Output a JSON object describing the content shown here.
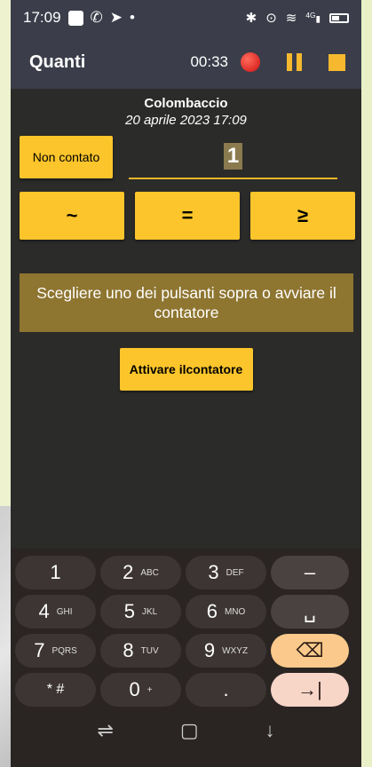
{
  "status_bar": {
    "time": "17:09",
    "icons_left": [
      "square-icon",
      "whatsapp-icon",
      "telegram-icon",
      "dot-icon"
    ],
    "icons_right": [
      "bluetooth-icon",
      "location-icon",
      "wifi-icon",
      "signal-icon",
      "battery-icon"
    ],
    "signal_label": "4G"
  },
  "app_bar": {
    "title": "Quanti",
    "timer": "00:33"
  },
  "session": {
    "name": "Colombaccio",
    "date": "20 aprile 2023 17:09"
  },
  "counter": {
    "not_counted_label": "Non contato",
    "value": "1"
  },
  "compare_buttons": [
    "~",
    "=",
    "≥"
  ],
  "message": "Scegliere uno dei pulsanti sopra o avviare il contatore",
  "start_button": {
    "line1": "Attivare il",
    "line2": "contatore"
  },
  "keyboard": {
    "rows": [
      [
        {
          "d": "1",
          "l": ""
        },
        {
          "d": "2",
          "l": "ABC"
        },
        {
          "d": "3",
          "l": "DEF"
        },
        {
          "fn": "–"
        }
      ],
      [
        {
          "d": "4",
          "l": "GHI"
        },
        {
          "d": "5",
          "l": "JKL"
        },
        {
          "d": "6",
          "l": "MNO"
        },
        {
          "fn": "␣"
        }
      ],
      [
        {
          "d": "7",
          "l": "PQRS"
        },
        {
          "d": "8",
          "l": "TUV"
        },
        {
          "d": "9",
          "l": "WXYZ"
        },
        {
          "fn": "⌫"
        }
      ],
      [
        {
          "d": "* #",
          "l": ""
        },
        {
          "d": "0",
          "l": "+"
        },
        {
          "d": ".",
          "l": ""
        },
        {
          "fn": "→|"
        }
      ]
    ]
  },
  "nav_bar": [
    "recents-icon",
    "home-icon",
    "back-icon"
  ]
}
